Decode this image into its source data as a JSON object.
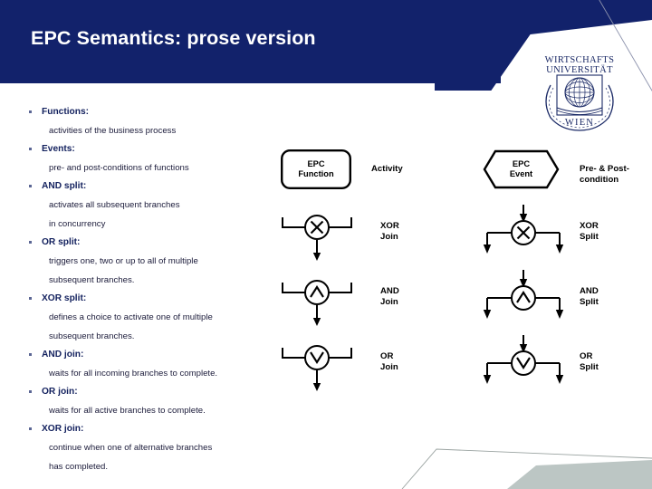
{
  "slide": {
    "title": "EPC Semantics: prose version",
    "header_color": "#12226b",
    "accent_text_color": "#13215e"
  },
  "logo": {
    "line1": "WIRTSCHAFTS",
    "line2": "UNIVERSITÄT",
    "line3": "WIEN",
    "name": "wu-wien-logo"
  },
  "prose": {
    "items": [
      {
        "term": "Functions:",
        "lines": [
          "activities of the business process"
        ]
      },
      {
        "term": "Events:",
        "lines": [
          "pre- and post-conditions of functions"
        ]
      },
      {
        "term": "AND split:",
        "lines": [
          "activates all subsequent branches",
          "in concurrency"
        ]
      },
      {
        "term": "OR split:",
        "lines": [
          "triggers one, two or up to all of multiple",
          "subsequent branches."
        ]
      },
      {
        "term": "XOR split:",
        "lines": [
          "defines a choice to activate one of multiple",
          "subsequent branches."
        ]
      },
      {
        "term": "AND join:",
        "lines": [
          "waits for all incoming branches to complete."
        ]
      },
      {
        "term": "OR join:",
        "lines": [
          "waits for all active branches to complete."
        ]
      },
      {
        "term": "XOR join:",
        "lines": [
          "continue when one of alternative branches",
          "has completed."
        ]
      }
    ]
  },
  "diagram": {
    "function_shape": {
      "label": "EPC\nFunction",
      "caption": "Activity"
    },
    "event_shape": {
      "label": "EPC\nEvent",
      "caption": "Pre- & Post-\ncondition"
    },
    "joins": [
      {
        "glyph": "xor",
        "caption": "XOR\nJoin"
      },
      {
        "glyph": "and",
        "caption": "AND\nJoin"
      },
      {
        "glyph": "or",
        "caption": "OR\nJoin"
      }
    ],
    "splits": [
      {
        "glyph": "xor",
        "caption": "XOR\nSplit"
      },
      {
        "glyph": "and",
        "caption": "AND\nSplit"
      },
      {
        "glyph": "or",
        "caption": "OR\nSplit"
      }
    ]
  }
}
